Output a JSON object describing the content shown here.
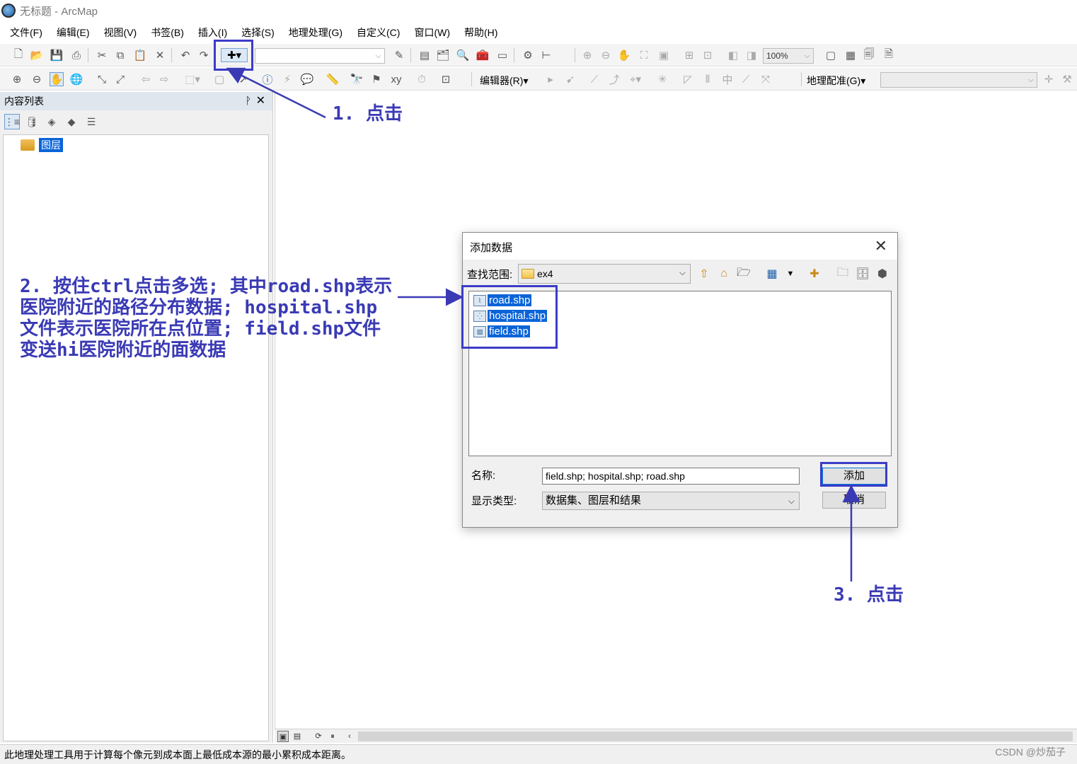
{
  "window": {
    "title": "无标题 - ArcMap"
  },
  "menu": [
    "文件(F)",
    "编辑(E)",
    "视图(V)",
    "书签(B)",
    "插入(I)",
    "选择(S)",
    "地理处理(G)",
    "自定义(C)",
    "窗口(W)",
    "帮助(H)"
  ],
  "toolbar": {
    "zoom_value": "100%",
    "editor_label": "编辑器(R)",
    "editor_arrow": "▾",
    "georef_label": "地理配准(G)",
    "georef_arrow": "▾"
  },
  "toc": {
    "title": "内容列表",
    "pin_glyph": "ᚹ",
    "close_glyph": "✕",
    "layer_name": "图层"
  },
  "dialog": {
    "title": "添加数据",
    "look_in_label": "查找范围:",
    "look_in_value": "ex4",
    "files": [
      "road.shp",
      "hospital.shp",
      "field.shp"
    ],
    "name_label": "名称:",
    "name_value": "field.shp; hospital.shp; road.shp",
    "type_label": "显示类型:",
    "type_value": "数据集、图层和结果",
    "add_button": "添加",
    "cancel_button": "取消"
  },
  "annotations": {
    "step1": "1. 点击",
    "step2_lines": [
      "2. 按住ctrl点击多选; 其中road.shp表示",
      "医院附近的路径分布数据; hospital.shp",
      "文件表示医院所在点位置; field.shp文件",
      "变送hi医院附近的面数据"
    ],
    "step3": "3. 点击"
  },
  "status": {
    "message": "此地理处理工具用于计算每个像元到成本面上最低成本源的最小累积成本距离。",
    "watermark": "CSDN @炒茄子"
  },
  "colors": {
    "annotation": "#3a3ab5",
    "selection": "#0a64d8"
  }
}
